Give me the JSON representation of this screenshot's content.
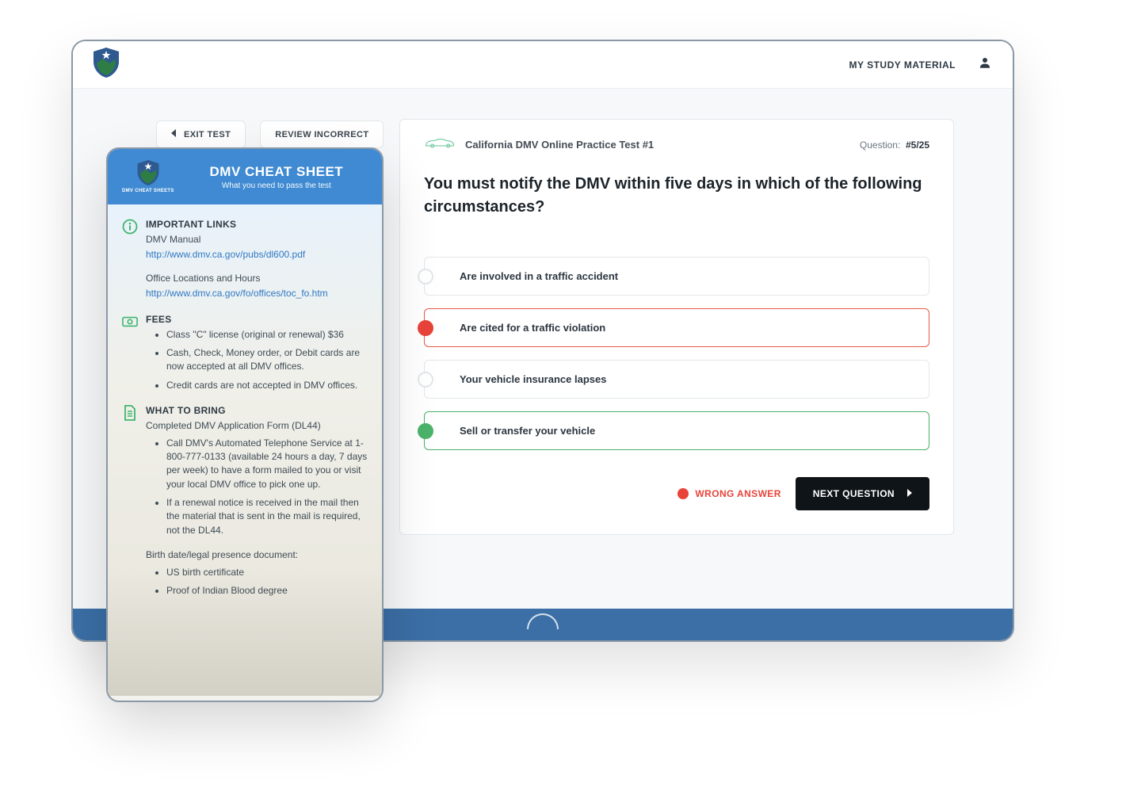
{
  "topbar": {
    "nav_label": "MY STUDY MATERIAL"
  },
  "left_controls": {
    "exit_label": "EXIT TEST",
    "review_label": "REVIEW INCORRECT"
  },
  "quiz": {
    "test_name": "California DMV Online Practice Test #1",
    "question_label": "Question:",
    "question_counter": "#5/25",
    "question_text": "You must notify the DMV within five days in which of the following circumstances?",
    "answers": [
      {
        "label": "Are involved in a traffic accident",
        "state": "default"
      },
      {
        "label": "Are cited for a traffic violation",
        "state": "wrong"
      },
      {
        "label": "Your vehicle insurance lapses",
        "state": "default"
      },
      {
        "label": "Sell or transfer your vehicle",
        "state": "correct"
      }
    ],
    "wrong_msg": "WRONG ANSWER",
    "next_label": "NEXT QUESTION"
  },
  "cheat_sheet": {
    "brand_sub": "DMV CHEAT SHEETS",
    "title": "DMV CHEAT SHEET",
    "subtitle": "What you need to pass the test",
    "sections": {
      "links": {
        "heading": "IMPORTANT LINKS",
        "manual_label": "DMV Manual",
        "manual_url": "http://www.dmv.ca.gov/pubs/dl600.pdf",
        "office_label": "Office Locations and Hours",
        "office_url": "http://www.dmv.ca.gov/fo/offices/toc_fo.htm"
      },
      "fees": {
        "heading": "FEES",
        "items": [
          "Class \"C\" license (original or renewal) $36",
          "Cash, Check, Money order, or Debit cards are now accepted at all DMV offices.",
          "Credit cards are not accepted in DMV offices."
        ]
      },
      "bring": {
        "heading": "WHAT TO BRING",
        "intro": "Completed DMV Application Form (DL44)",
        "items": [
          "Call DMV's Automated Telephone Service at 1-800-777-0133 (available 24 hours a day, 7 days per week) to have a form mailed to you or visit your local DMV office to pick one up.",
          "If a renewal notice is received in the mail then the material that is sent in the mail is required, not the DL44."
        ],
        "birth_label": "Birth date/legal presence document:",
        "birth_items": [
          "US birth certificate",
          "Proof of Indian Blood degree"
        ]
      }
    }
  },
  "colors": {
    "brand_blue": "#3b6fa6",
    "link_blue": "#2f78c4",
    "wrong_red": "#e8433a",
    "correct_green": "#4bb36a"
  }
}
